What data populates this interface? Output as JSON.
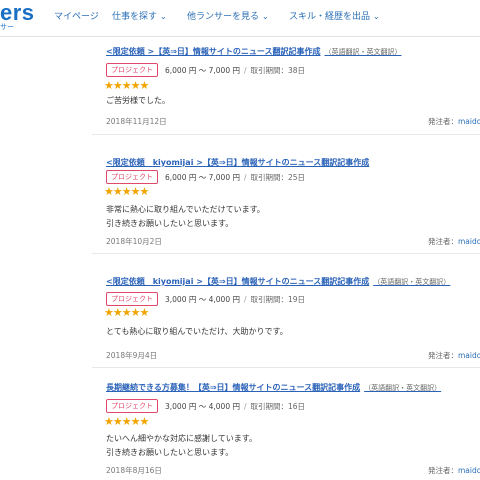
{
  "header": {
    "logo": "ers",
    "logo_sub": "サー",
    "nav": [
      {
        "label": "マイページ",
        "has_caret": false
      },
      {
        "label": "仕事を探す",
        "has_caret": true
      },
      {
        "label": "他ランサーを見る",
        "has_caret": true
      },
      {
        "label": "スキル・経歴を出品",
        "has_caret": true
      }
    ]
  },
  "reviews": [
    {
      "title": "<限定依頼 >【英⇒日】情報サイトのニュース翻訳記事作成",
      "category": "（英語翻訳・英文翻訳）",
      "badge": "プロジェクト",
      "price": "6,000 円 〜 7,000 円",
      "duration": "取引期間：38日",
      "rating": 5,
      "comment": "ご苦労様でした。",
      "date": "2018年11月12日",
      "orderer_label": "発注者：",
      "orderer_name": "maido"
    },
    {
      "title": "<限定依頼　kiyomijai >【英⇒日】情報サイトのニュース翻訳記事作成",
      "category": "",
      "badge": "プロジェクト",
      "price": "6,000 円 〜 7,000 円",
      "duration": "取引期間：25日",
      "rating": 5,
      "comment": "非常に熱心に取り組んでいただけています。\n引き続きお願いしたいと思います。",
      "date": "2018年10月2日",
      "orderer_label": "発注者：",
      "orderer_name": "maido"
    },
    {
      "title": "<限定依頼　kiyomijai >【英⇒日】情報サイトのニュース翻訳記事作成",
      "category": "（英語翻訳・英文翻訳）",
      "badge": "プロジェクト",
      "price": "3,000 円 〜 4,000 円",
      "duration": "取引期間：19日",
      "rating": 5,
      "comment": "とても熱心に取り組んでいただけ、大助かりです。",
      "date": "2018年9月4日",
      "orderer_label": "発注者：",
      "orderer_name": "maido"
    },
    {
      "title": "長期継続できる方募集！【英⇒日】情報サイトのニュース翻訳記事作成",
      "category": "（英語翻訳・英文翻訳）",
      "badge": "プロジェクト",
      "price": "3,000 円 〜 4,000 円",
      "duration": "取引期間：16日",
      "rating": 5,
      "comment": "たいへん細やかな対応に感謝しています。\n引き続きお願いしたいと思います。",
      "date": "2018年8月16日",
      "orderer_label": "発注者：",
      "orderer_name": "maido"
    }
  ],
  "colors": {
    "accent": "#2a62b8",
    "badge": "#e0496b",
    "star": "#f0a500"
  }
}
